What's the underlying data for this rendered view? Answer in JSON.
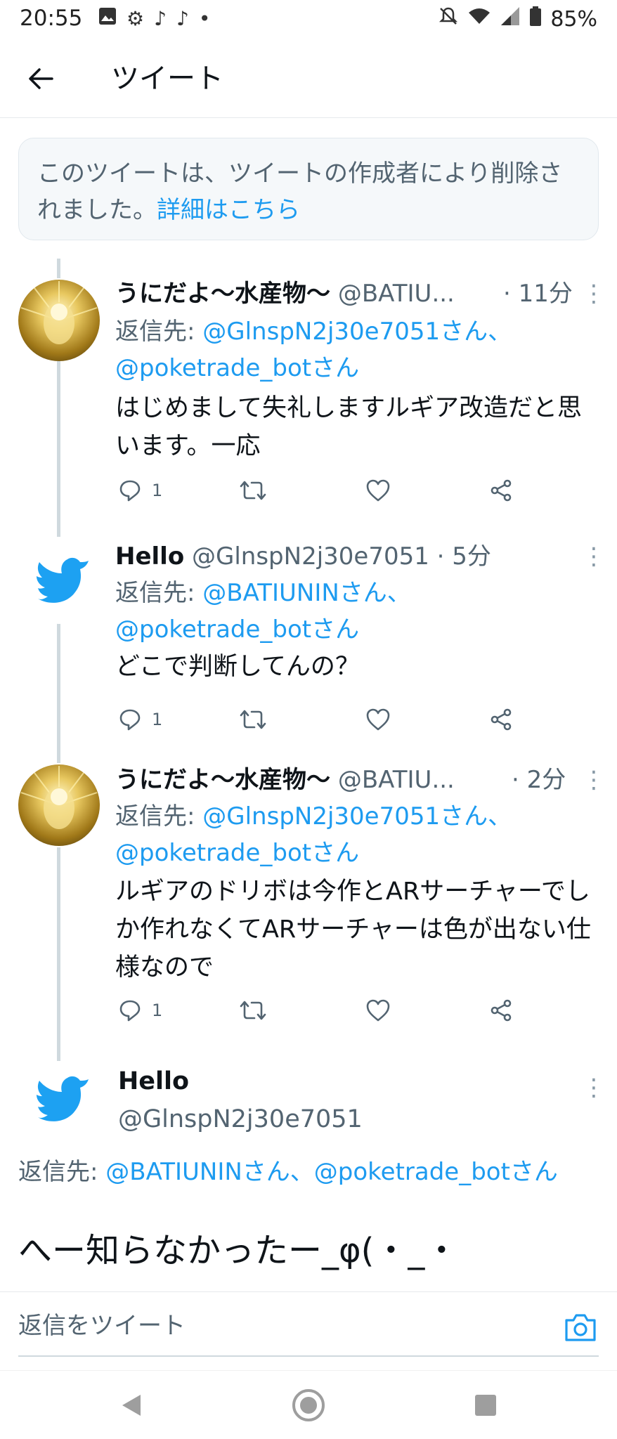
{
  "status_bar": {
    "time": "20:55",
    "battery": "85%"
  },
  "header": {
    "title": "ツイート"
  },
  "deleted_notice": {
    "text": "このツイートは、ツイートの作成者により削除されました。",
    "link": "詳細はこちら"
  },
  "tweets": [
    {
      "name": "うにだよ〜水産物〜",
      "handle": "@BATIU...",
      "time": "· 11分",
      "reply_prefix": "返信先: ",
      "reply_to_1": "@GlnspN2j30e7051さん、",
      "reply_to_2": "@poketrade_botさん",
      "text": "はじめまして失礼しますルギア改造だと思います。一応",
      "reply_count": "1"
    },
    {
      "name": "Hello",
      "handle": "@GlnspN2j30e7051 · 5分",
      "reply_prefix": "返信先: ",
      "reply_to_1": "@BATIUNINさん、",
      "reply_to_2": "@poketrade_botさん",
      "text": "どこで判断してんの？",
      "reply_count": "1"
    },
    {
      "name": "うにだよ〜水産物〜",
      "handle": "@BATIU...",
      "time": "· 2分",
      "reply_prefix": "返信先: ",
      "reply_to_1": "@GlnspN2j30e7051さん、",
      "reply_to_2": "@poketrade_botさん",
      "text": "ルギアのドリボは今作とARサーチャーでしか作れなくてARサーチャーは色が出ない仕様なので",
      "reply_count": "1"
    }
  ],
  "main_tweet": {
    "name": "Hello",
    "handle": "@GlnspN2j30e7051",
    "reply_prefix": "返信先: ",
    "reply_to": "@BATIUNINさん、@poketrade_botさん",
    "text": "へー知らなかったー_φ(・_・"
  },
  "reply_bar": {
    "placeholder": "返信をツイート"
  },
  "colors": {
    "link": "#1d9bf0",
    "secondary_text": "#536471"
  }
}
